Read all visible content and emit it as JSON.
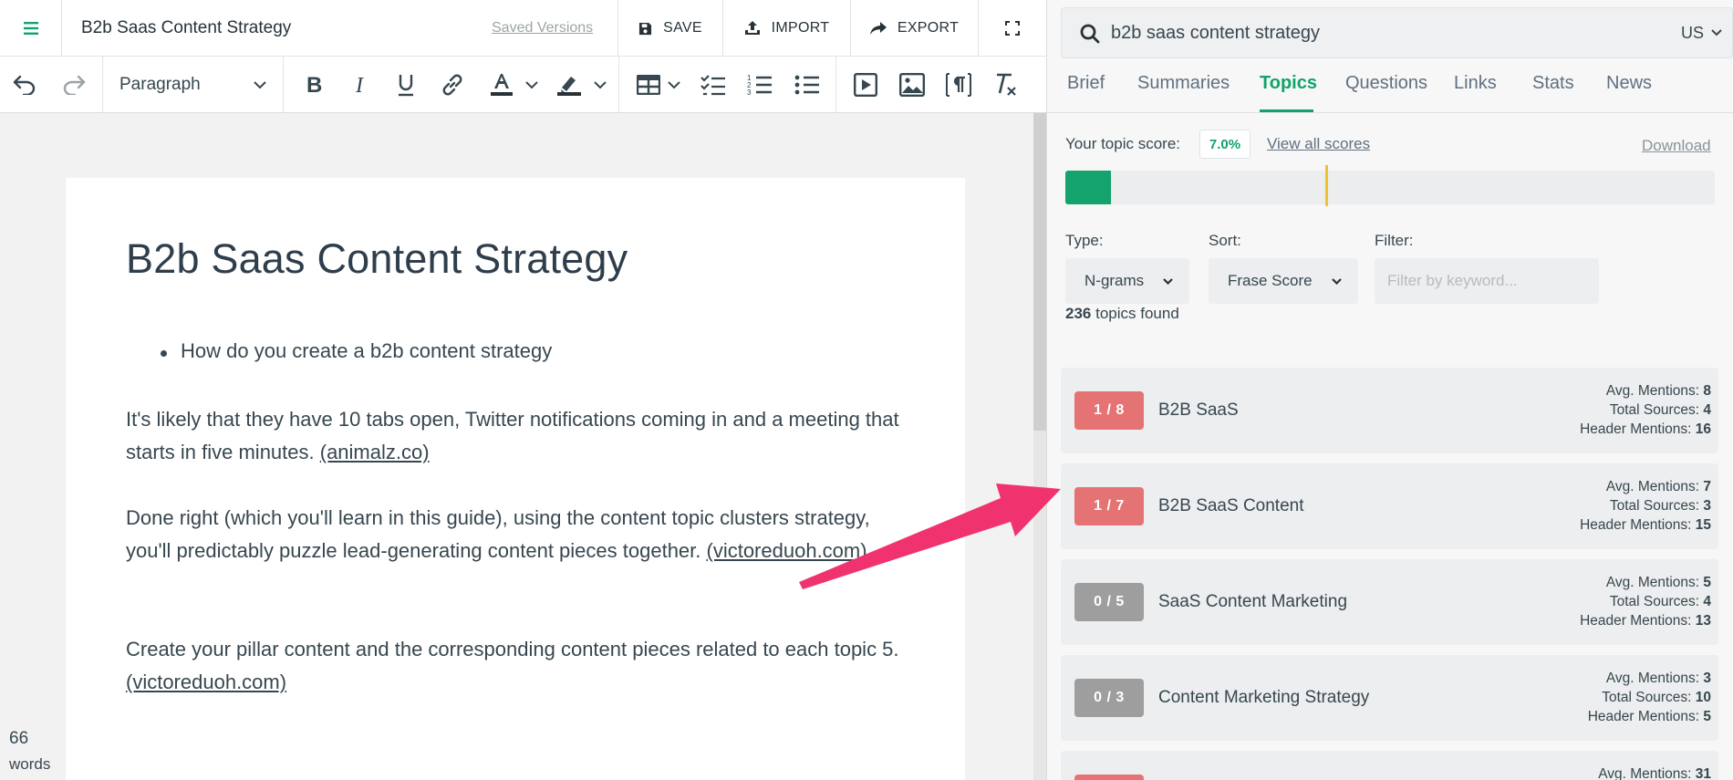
{
  "topbar": {
    "doc_title": "B2b Saas Content Strategy",
    "saved_versions": "Saved Versions",
    "save_label": "SAVE",
    "import_label": "IMPORT",
    "export_label": "EXPORT"
  },
  "toolbar": {
    "block_format": "Paragraph"
  },
  "document": {
    "heading": "B2b Saas Content Strategy",
    "bullets": [
      "How do you create a b2b content strategy"
    ],
    "paragraphs": [
      {
        "text": "It's likely that they have 10 tabs open, Twitter notifications coming in and a meeting that starts in five minutes. ",
        "source": "(animalz.co)"
      },
      {
        "text": "Done right (which you'll learn in this guide), using the content topic clusters strategy, you'll predictably puzzle lead-generating content pieces together. ",
        "source": "(victoreduoh.com)"
      },
      {
        "text": "Create your pillar content and the corresponding content pieces related to each topic 5. ",
        "source": "(victoreduoh.com)"
      }
    ],
    "word_count": "66",
    "word_count_unit": "words"
  },
  "sidebar": {
    "search_query": "b2b saas content strategy",
    "region": "US",
    "tabs": [
      "Brief",
      "Summaries",
      "Topics",
      "Questions",
      "Links",
      "Stats",
      "News"
    ],
    "active_tab": "Topics",
    "score_label": "Your topic score:",
    "score_value": "7.0%",
    "score_fraction": 0.07,
    "target_fraction": 0.4,
    "view_scores": "View all scores",
    "download": "Download",
    "type_label": "Type:",
    "type_value": "N-grams",
    "sort_label": "Sort:",
    "sort_value": "Frase Score",
    "filter_label": "Filter:",
    "filter_placeholder": "Filter by keyword...",
    "topics_count": "236",
    "topics_found_suffix": " topics found",
    "topics": [
      {
        "badge": "1 / 8",
        "status": "red",
        "name": "B2B SaaS",
        "avg_label": "Avg. Mentions:",
        "avg": "8",
        "sources_label": "Total Sources:",
        "sources": "4",
        "header_label": "Header Mentions:",
        "header": "16"
      },
      {
        "badge": "1 / 7",
        "status": "red",
        "name": "B2B SaaS Content",
        "avg_label": "Avg. Mentions:",
        "avg": "7",
        "sources_label": "Total Sources:",
        "sources": "3",
        "header_label": "Header Mentions:",
        "header": "15"
      },
      {
        "badge": "0 / 5",
        "status": "gray",
        "name": "SaaS Content Marketing",
        "avg_label": "Avg. Mentions:",
        "avg": "5",
        "sources_label": "Total Sources:",
        "sources": "4",
        "header_label": "Header Mentions:",
        "header": "13"
      },
      {
        "badge": "0 / 3",
        "status": "gray",
        "name": "Content Marketing Strategy",
        "avg_label": "Avg. Mentions:",
        "avg": "3",
        "sources_label": "Total Sources:",
        "sources": "10",
        "header_label": "Header Mentions:",
        "header": "5"
      },
      {
        "badge": "",
        "status": "red",
        "name": "",
        "avg_label": "Avg. Mentions:",
        "avg": "31",
        "sources_label": "",
        "sources": "",
        "header_label": "",
        "header": ""
      }
    ]
  },
  "colors": {
    "accent_green": "#10a36b",
    "badge_red": "#e57373",
    "badge_gray": "#9e9e9e",
    "target_marker": "#f2c12e",
    "annotation_arrow": "#f0336e"
  }
}
